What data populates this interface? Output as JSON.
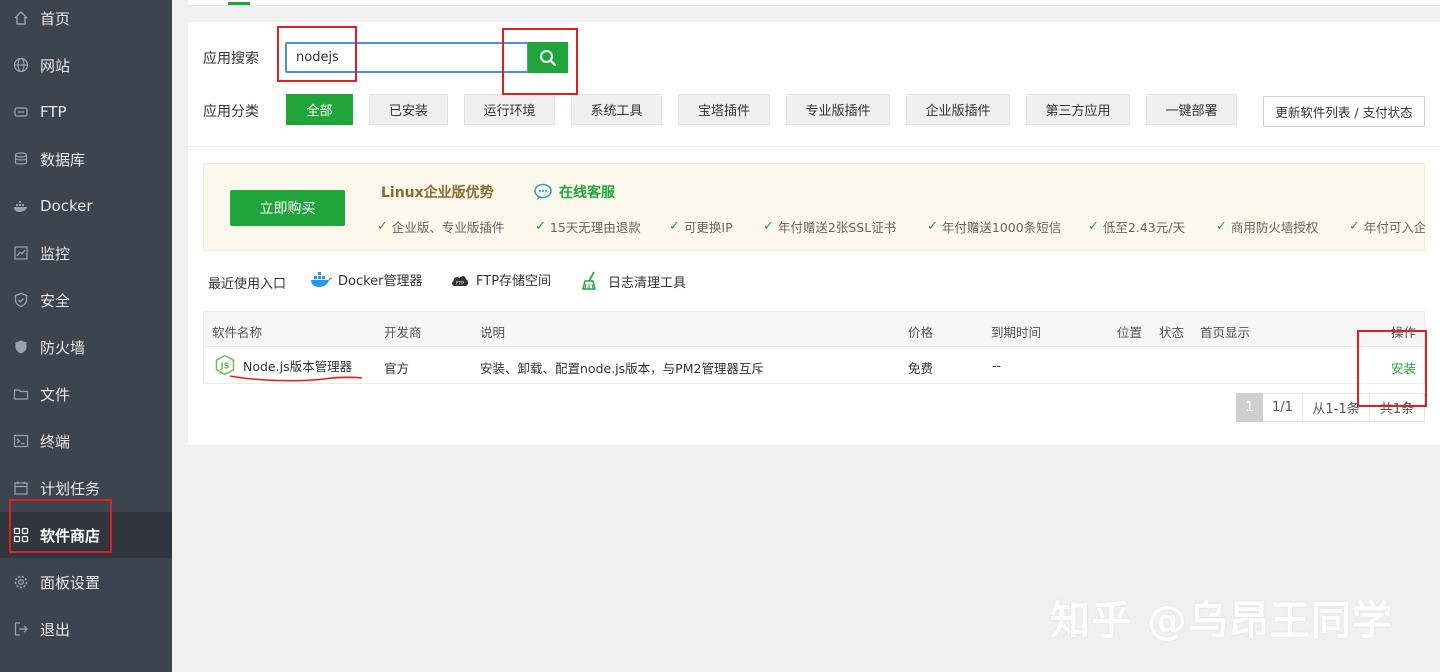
{
  "sidebar": {
    "items": [
      {
        "label": "首页",
        "icon": "home-icon"
      },
      {
        "label": "网站",
        "icon": "globe-icon"
      },
      {
        "label": "FTP",
        "icon": "ftp-icon"
      },
      {
        "label": "数据库",
        "icon": "database-icon"
      },
      {
        "label": "Docker",
        "icon": "docker-icon"
      },
      {
        "label": "监控",
        "icon": "monitor-icon"
      },
      {
        "label": "安全",
        "icon": "shield-icon"
      },
      {
        "label": "防火墙",
        "icon": "firewall-icon"
      },
      {
        "label": "文件",
        "icon": "folder-icon"
      },
      {
        "label": "终端",
        "icon": "terminal-icon"
      },
      {
        "label": "计划任务",
        "icon": "calendar-icon"
      },
      {
        "label": "软件商店",
        "icon": "grid-icon",
        "active": true
      },
      {
        "label": "面板设置",
        "icon": "gear-icon"
      },
      {
        "label": "退出",
        "icon": "logout-icon"
      }
    ]
  },
  "search": {
    "label": "应用搜索",
    "value": "nodejs"
  },
  "categories": {
    "label": "应用分类",
    "items": [
      "全部",
      "已安装",
      "运行环境",
      "系统工具",
      "宝塔插件",
      "专业版插件",
      "企业版插件",
      "第三方应用",
      "一键部署"
    ],
    "update_button": "更新软件列表 / 支付状态"
  },
  "promo": {
    "buy_button": "立即购买",
    "title": "Linux企业版优势",
    "customer_service": "在线客服",
    "features": [
      "企业版、专业版插件",
      "15天无理由退款",
      "可更换IP",
      "年付赠送2张SSL证书",
      "年付赠送1000条短信",
      "低至2.43元/天",
      "商用防火墙授权",
      "年付可入企"
    ]
  },
  "recent": {
    "label": "最近使用入口",
    "items": [
      "Docker管理器",
      "FTP存储空间",
      "日志清理工具"
    ]
  },
  "table": {
    "headers": {
      "name": "软件名称",
      "developer": "开发商",
      "desc": "说明",
      "price": "价格",
      "expire": "到期时间",
      "location": "位置",
      "status": "状态",
      "home": "首页显示",
      "action": "操作"
    },
    "rows": [
      {
        "name": "Node.js版本管理器",
        "developer": "官方",
        "desc": "安装、卸载、配置node.js版本，与PM2管理器互斥",
        "price": "免费",
        "expire": "--",
        "action": "安装"
      }
    ]
  },
  "pagination": {
    "current": "1",
    "pages": "1/1",
    "range": "从1-1条",
    "total": "共1条"
  },
  "watermark": "知乎 @乌昂王同学",
  "colors": {
    "accent": "#20a53a",
    "sidebar": "#3c444d",
    "annotation": "#e02020"
  }
}
